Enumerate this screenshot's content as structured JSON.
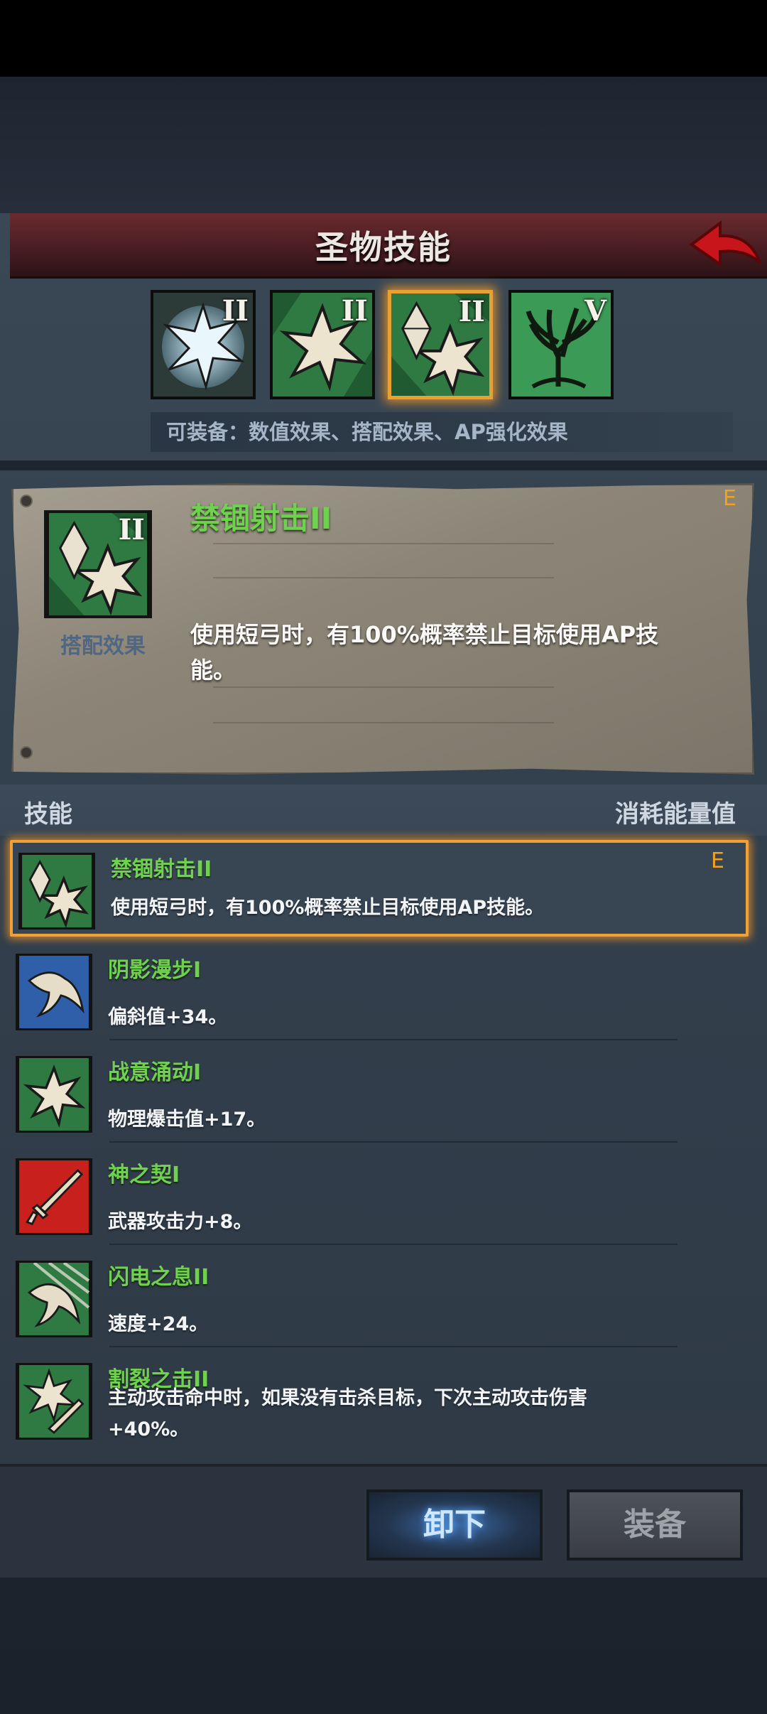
{
  "header": {
    "title": "圣物技能"
  },
  "slots": [
    {
      "rank": "II",
      "icon": "frost-burst-icon"
    },
    {
      "rank": "II",
      "icon": "star-burst-icon"
    },
    {
      "rank": "II",
      "icon": "crystal-burst-icon",
      "selected": true
    },
    {
      "rank": "V",
      "icon": "tree-icon"
    }
  ],
  "equip_hint": "可装备：数值效果、搭配效果、AP强化效果",
  "detail": {
    "rank": "II",
    "type": "搭配效果",
    "title": "禁锢射击II",
    "grade": "E",
    "desc": "使用短弓时，有100%概率禁止目标使用AP技能。"
  },
  "list_header": {
    "left": "技能",
    "right": "消耗能量值"
  },
  "skills": [
    {
      "name": "禁锢射击II",
      "desc": "使用短弓时，有100%概率禁止目标使用AP技能。",
      "grade": "E",
      "icon": "crystal-burst-icon"
    },
    {
      "name": "阴影漫步I",
      "desc": "偏斜值+34。",
      "icon": "bird-icon"
    },
    {
      "name": "战意涌动I",
      "desc": "物理爆击值+17。",
      "icon": "star-burst-icon"
    },
    {
      "name": "神之契I",
      "desc": "武器攻击力+8。",
      "icon": "sword-icon"
    },
    {
      "name": "闪电之息II",
      "desc": "速度+24。",
      "icon": "lightning-bird-icon"
    },
    {
      "name": "割裂之击II",
      "desc": "主动攻击命中时，如果没有击杀目标，下次主动攻击伤害+40%。",
      "icon": "burst-sword-icon"
    }
  ],
  "buttons": {
    "unequip": "卸下",
    "equip": "装备"
  },
  "colors": {
    "skill_name": "#6fd14f",
    "grade": "#f0a21f",
    "selected_border": "#f0a035",
    "header": "#5a2328"
  }
}
